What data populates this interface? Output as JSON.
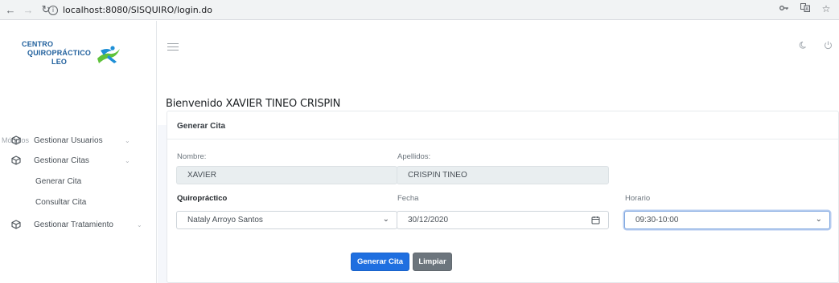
{
  "browser": {
    "url": "localhost:8080/SISQUIRO/login.do",
    "back_icon": "arrow-left-icon",
    "forward_icon": "arrow-right-icon",
    "reload_icon": "reload-icon",
    "info_icon": "info-icon",
    "right_icons": [
      "key-icon",
      "translate-icon",
      "star-icon"
    ]
  },
  "logo": {
    "line1": "CENTRO",
    "line2": "QUIROPRÁCTICO",
    "line3": "LEO"
  },
  "sidebar": {
    "modules_label": "Módulos",
    "items": [
      {
        "label": "Gestionar Usuarios",
        "icon": "cube-icon"
      },
      {
        "label": "Gestionar Citas",
        "icon": "cube-icon"
      },
      {
        "label": "Gestionar Tratamiento",
        "icon": "cube-icon"
      }
    ],
    "sub_items": [
      {
        "label": "Generar Cita"
      },
      {
        "label": "Consultar Cita"
      }
    ]
  },
  "header": {
    "welcome": "Bienvenido XAVIER TINEO CRISPIN",
    "icons": [
      "theme-icon",
      "power-icon"
    ]
  },
  "form": {
    "title": "Generar Cita",
    "nombre_label": "Nombre:",
    "nombre_value": "XAVIER",
    "apellidos_label": "Apellidos:",
    "apellidos_value": "CRISPIN TINEO",
    "quiro_label": "Quiropráctico",
    "quiro_value": "Nataly Arroyo Santos",
    "fecha_label": "Fecha",
    "fecha_value": "30/12/2020",
    "horario_label": "Horario",
    "horario_value": "09:30-10:00",
    "generate_label": "Generar Cita",
    "clear_label": "Limpiar"
  },
  "colors": {
    "primary": "#1f6fe0",
    "secondary": "#6c757d",
    "logo_blue": "#1f5f9c",
    "logo_green": "#5fc23b",
    "logo_blue_figure": "#1e8fd6"
  }
}
